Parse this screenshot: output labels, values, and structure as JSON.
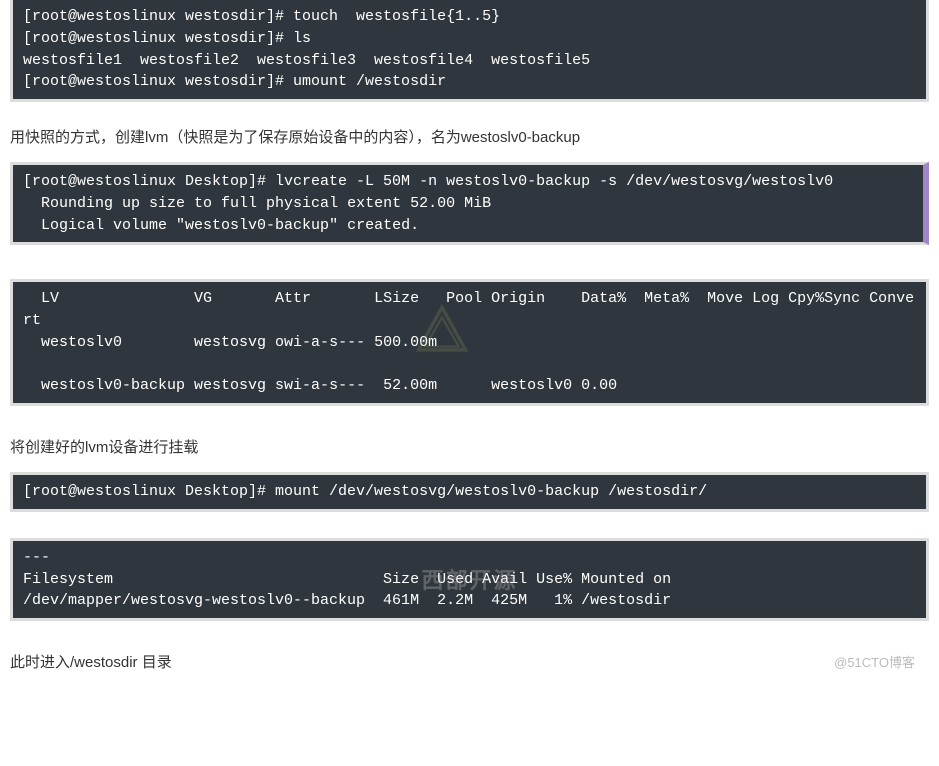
{
  "block1": {
    "line1": "[root@westoslinux westosdir]# touch  westosfile{1..5}",
    "line2": "[root@westoslinux westosdir]# ls",
    "line3": "westosfile1  westosfile2  westosfile3  westosfile4  westosfile5",
    "line4": "[root@westoslinux westosdir]# umount /westosdir"
  },
  "text1": "用快照的方式，创建lvm（快照是为了保存原始设备中的内容），名为westoslv0-backup",
  "block2": {
    "line1": "[root@westoslinux Desktop]# lvcreate -L 50M -n westoslv0-backup -s /dev/westosvg/westoslv0",
    "line2": "  Rounding up size to full physical extent 52.00 MiB",
    "line3": "  Logical volume \"westoslv0-backup\" created."
  },
  "block3": {
    "line1": "  LV               VG       Attr       LSize   Pool Origin    Data%  Meta%  Move Log Cpy%Sync Convert",
    "line2": "  westoslv0        westosvg owi-a-s--- 500.00m",
    "line3": "",
    "line4": "  westoslv0-backup westosvg swi-a-s---  52.00m      westoslv0 0.00"
  },
  "text2": "将创建好的lvm设备进行挂载",
  "block4": {
    "line1": "[root@westoslinux Desktop]# mount /dev/westosvg/westoslv0-backup /westosdir/"
  },
  "block5": {
    "line1": "---",
    "line2": "Filesystem                              Size  Used Avail Use% Mounted on",
    "line3": "/dev/mapper/westosvg-westoslv0--backup  461M  2.2M  425M   1% /westosdir"
  },
  "text3": "此时进入/westosdir 目录",
  "watermark": "@51CTO博客",
  "center_watermark1": "西部开源"
}
